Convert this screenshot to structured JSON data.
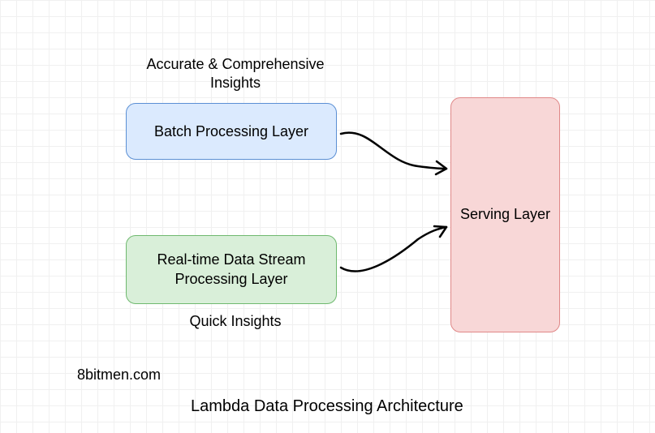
{
  "diagram": {
    "title": "Lambda Data Processing Architecture",
    "attribution": "8bitmen.com",
    "boxes": {
      "batch": {
        "label": "Batch Processing Layer",
        "annotation": "Accurate & Comprehensive Insights",
        "color": "#dbeafe",
        "border": "#5b8fd4"
      },
      "stream": {
        "label": "Real-time Data Stream Processing Layer",
        "annotation": "Quick Insights",
        "color": "#d9efd9",
        "border": "#6fb96f"
      },
      "serving": {
        "label": "Serving Layer",
        "color": "#f8d7d7",
        "border": "#e08888"
      }
    },
    "arrows": [
      {
        "from": "batch",
        "to": "serving"
      },
      {
        "from": "stream",
        "to": "serving"
      }
    ]
  }
}
